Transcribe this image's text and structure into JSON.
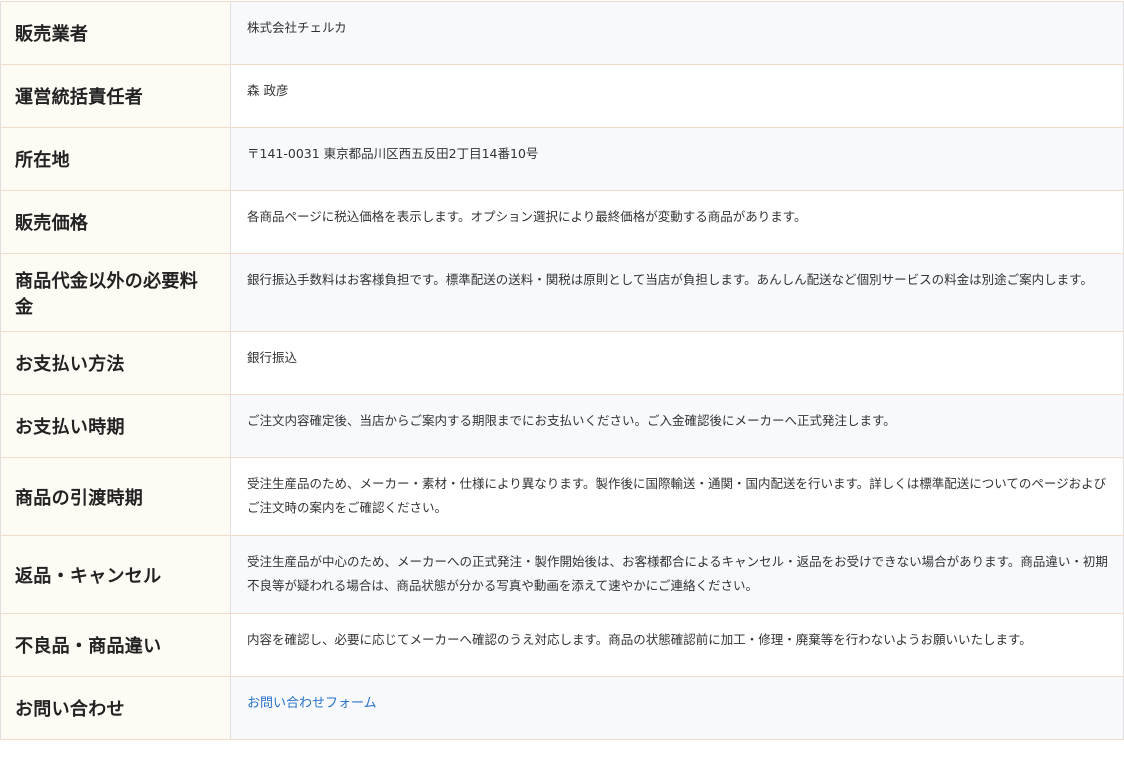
{
  "table": {
    "rows": [
      {
        "label": "販売業者",
        "value": "株式会社チェルカ"
      },
      {
        "label": "運営統括責任者",
        "value": "森 政彦"
      },
      {
        "label": "所在地",
        "value": "〒141-0031 東京都品川区西五反田2丁目14番10号"
      },
      {
        "label": "販売価格",
        "value": "各商品ページに税込価格を表示します。オプション選択により最終価格が変動する商品があります。"
      },
      {
        "label": "商品代金以外の必要料金",
        "value": "銀行振込手数料はお客様負担です。標準配送の送料・関税は原則として当店が負担します。あんしん配送など個別サービスの料金は別途ご案内します。"
      },
      {
        "label": "お支払い方法",
        "value": "銀行振込"
      },
      {
        "label": "お支払い時期",
        "value": "ご注文内容確定後、当店からご案内する期限までにお支払いください。ご入金確認後にメーカーへ正式発注します。"
      },
      {
        "label": "商品の引渡時期",
        "value": "受注生産品のため、メーカー・素材・仕様により異なります。製作後に国際輸送・通関・国内配送を行います。詳しくは標準配送についてのページおよびご注文時の案内をご確認ください。"
      },
      {
        "label": "返品・キャンセル",
        "value": "受注生産品が中心のため、メーカーへの正式発注・製作開始後は、お客様都合によるキャンセル・返品をお受けできない場合があります。商品違い・初期不良等が疑われる場合は、商品状態が分かる写真や動画を添えて速やかにご連絡ください。"
      },
      {
        "label": "不良品・商品違い",
        "value": "内容を確認し、必要に応じてメーカーへ確認のうえ対応します。商品の状態確認前に加工・修理・廃棄等を行わないようお願いいたします。"
      },
      {
        "label": "お問い合わせ",
        "value": "お問い合わせフォーム"
      }
    ]
  },
  "colors": {
    "header_bg": "#fefaf4",
    "link": "#2a73c9"
  }
}
